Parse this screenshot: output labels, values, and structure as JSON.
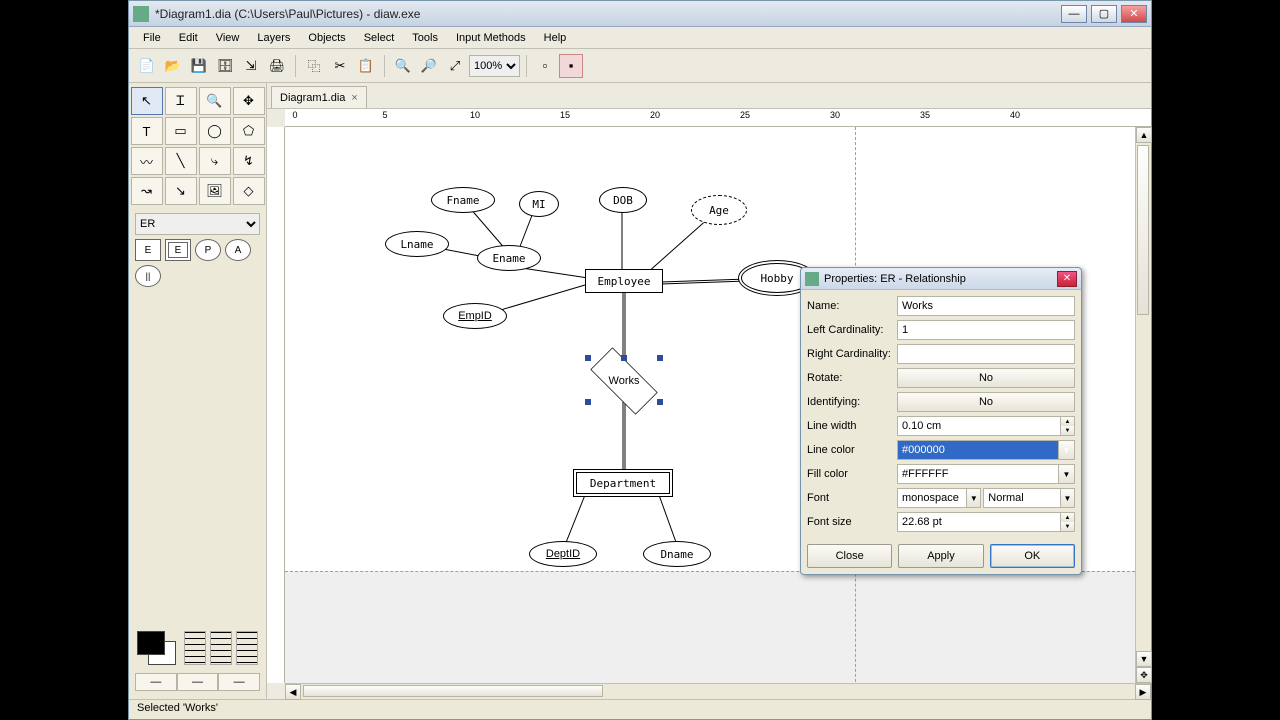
{
  "window": {
    "title": "*Diagram1.dia (C:\\Users\\Paul\\Pictures) - diaw.exe",
    "min": "—",
    "max": "▢",
    "close": "✕"
  },
  "menu": [
    "File",
    "Edit",
    "View",
    "Layers",
    "Objects",
    "Select",
    "Tools",
    "Input Methods",
    "Help"
  ],
  "zoom": "100%",
  "tab": {
    "label": "Diagram1.dia",
    "close": "×"
  },
  "shapeCategory": "ER",
  "erbuttons": [
    "E",
    "E",
    "P",
    "A"
  ],
  "status": "Selected 'Works'",
  "rulerTicks": [
    0,
    5,
    10,
    15,
    20,
    25,
    30,
    35,
    40
  ],
  "shapes": {
    "fname": "Fname",
    "mi": "MI",
    "dob": "DOB",
    "age": "Age",
    "lname": "Lname",
    "ename": "Ename",
    "employee": "Employee",
    "hobby": "Hobby",
    "empid": "EmpID",
    "works": "Works",
    "department": "Department",
    "deptid": "DeptID",
    "dname": "Dname"
  },
  "dialog": {
    "title": "Properties: ER - Relationship",
    "labels": {
      "name": "Name:",
      "leftcard": "Left Cardinality:",
      "rightcard": "Right Cardinality:",
      "rotate": "Rotate:",
      "identifying": "Identifying:",
      "linewidth": "Line width",
      "linecolor": "Line color",
      "fillcolor": "Fill color",
      "font": "Font",
      "fontsize": "Font size"
    },
    "values": {
      "name": "Works",
      "leftcard": "1",
      "rightcard": "",
      "rotate": "No",
      "identifying": "No",
      "linewidth": "0.10 cm",
      "linecolor": "#000000",
      "fillcolor": "#FFFFFF",
      "fontfamily": "monospace",
      "fontstyle": "Normal",
      "fontsize": "22.68 pt"
    },
    "buttons": {
      "close": "Close",
      "apply": "Apply",
      "ok": "OK"
    },
    "x": "✕"
  }
}
